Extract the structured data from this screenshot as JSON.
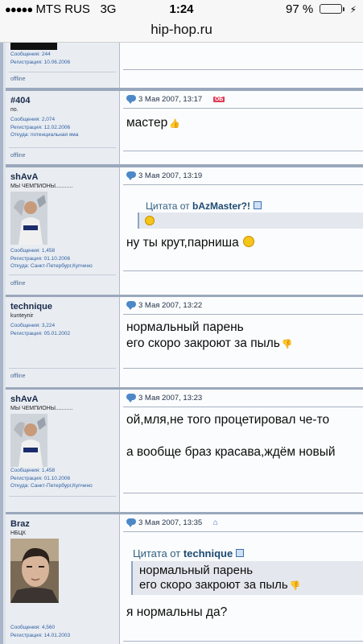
{
  "status_bar": {
    "carrier": "MTS RUS",
    "network": "3G",
    "time": "1:24",
    "battery_percent": "97 %",
    "battery_level": 0.97
  },
  "browser": {
    "url": "hip-hop.ru"
  },
  "posts": [
    {
      "username": "",
      "stats": [
        "Сообщения: 244",
        "Регистрация: 10.06.2006"
      ],
      "online_status": "offline"
    },
    {
      "username": "#404",
      "usertitle": "по.",
      "stats": [
        "Сообщения: 2,074",
        "Регистрация: 12.02.2006",
        "Откуда: потенциальная яма"
      ],
      "online_status": "offline",
      "date": "3 Мая 2007, 13:17",
      "badge": "ОБ",
      "message": [
        "мастер"
      ]
    },
    {
      "username": "shAvA",
      "usertitle": "МЫ ЧЕМПИОНЫ...........",
      "stats": [
        "Сообщения: 1,458",
        "Регистрация: 01.10.2006",
        "Откуда: Санкт-Петербург,Купчино"
      ],
      "online_status": "offline",
      "date": "3 Мая 2007, 13:19",
      "quote_label": "Цитата от",
      "quote_author": "bAzMaster?!",
      "message": [
        "ну ты крут,парниша"
      ]
    },
    {
      "username": "technique",
      "usertitle": "kunteynir",
      "stats": [
        "Сообщения: 3,224",
        "Регистрация: 05.01.2002"
      ],
      "online_status": "offline",
      "date": "3 Мая 2007, 13:22",
      "message": [
        "нормальный парень",
        "его скоро закроют за пыль"
      ]
    },
    {
      "username": "shAvA",
      "usertitle": "МЫ ЧЕМПИОНЫ...........",
      "stats": [
        "Сообщения: 1,458",
        "Регистрация: 01.10.2006",
        "Откуда: Санкт-Петербург,Купчино"
      ],
      "date": "3 Мая 2007, 13:23",
      "message": [
        "ой,мля,не того процетировал че-то",
        "а вообще браз красава,ждём новый"
      ]
    },
    {
      "username": "Braz",
      "usertitle": "НБЦК",
      "stats": [
        "Сообщения: 4,560",
        "Регистрация: 14.01.2003"
      ],
      "date": "3 Мая 2007, 13:35",
      "quote_label": "Цитата от",
      "quote_author": "technique",
      "quote_lines": [
        "нормальный парень",
        "его скоро закроют за пыль"
      ],
      "message": [
        "я нормальны да?"
      ]
    }
  ]
}
